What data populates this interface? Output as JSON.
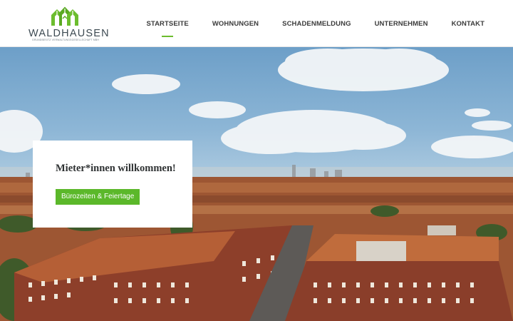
{
  "brand": {
    "name": "WALDHAUSEN",
    "tagline": "GRUNDBESITZ VERWALTUNGSGESELLSCHAFT MBH",
    "color_green": "#6cbd2e",
    "color_text": "#3d4a52"
  },
  "nav": {
    "items": [
      {
        "label": "STARTSEITE",
        "active": true
      },
      {
        "label": "WOHNUNGEN",
        "active": false
      },
      {
        "label": "SCHADENMELDUNG",
        "active": false
      },
      {
        "label": "UNTERNEHMEN",
        "active": false
      },
      {
        "label": "KONTAKT",
        "active": false
      }
    ]
  },
  "hero": {
    "image": "aerial-city-rooftops-photo",
    "card": {
      "title": "Mieter*innen willkommen!",
      "button_label": "Bürozeiten & Feiertage",
      "button_color": "#5bb82a"
    }
  }
}
